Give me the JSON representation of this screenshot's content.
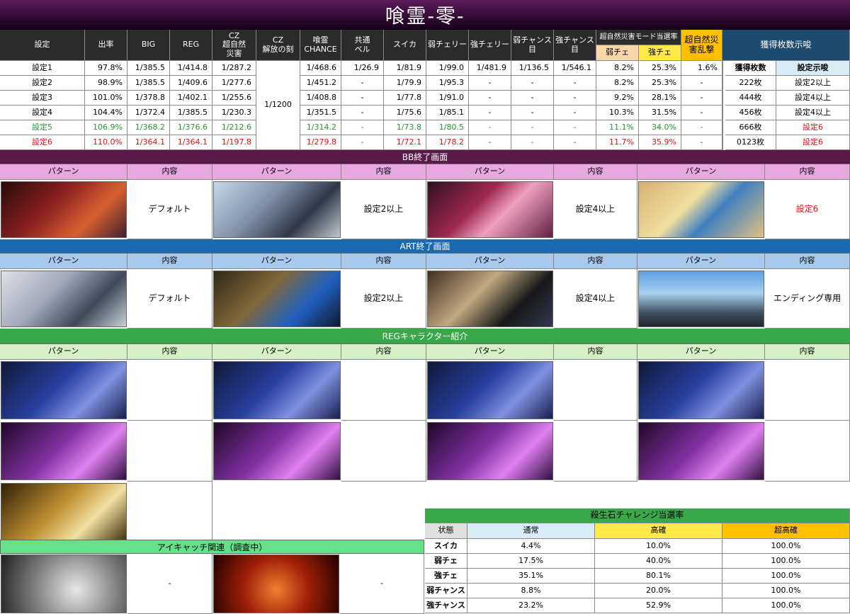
{
  "title": "喰霊-零-",
  "stats": {
    "headers": [
      "設定",
      "出率",
      "BIG",
      "REG",
      "CZ\n超自然\n災害",
      "CZ\n解放の刻",
      "喰霊\nCHANCE",
      "共通\nベル",
      "スイカ",
      "弱チェリー",
      "強チェリー",
      "弱チャンス\n目",
      "強チャンス\n目"
    ],
    "mode_header": "超自然災害モード当選率",
    "mode_sub": [
      "弱チェ",
      "強チェ"
    ],
    "ranbu_header": "超自然災\n害乱撃",
    "kakutoku_header": "獲得枚数示唆",
    "kakutoku_sub": [
      "獲得枚数",
      "設定示唆"
    ],
    "cz_kai": "1/1200",
    "rows": [
      [
        "設定1",
        "97.8%",
        "1/385.5",
        "1/414.8",
        "1/287.2",
        "1/468.6",
        "1/26.9",
        "1/81.9",
        "1/99.0",
        "1/481.9",
        "1/136.5",
        "1/546.1",
        "8.2%",
        "25.3%",
        "1.6%"
      ],
      [
        "設定2",
        "98.9%",
        "1/385.5",
        "1/409.6",
        "1/277.6",
        "1/451.2",
        "-",
        "1/79.9",
        "1/95.3",
        "-",
        "-",
        "-",
        "8.2%",
        "25.3%",
        "-"
      ],
      [
        "設定3",
        "101.0%",
        "1/378.8",
        "1/402.1",
        "1/255.6",
        "1/408.8",
        "-",
        "1/77.8",
        "1/91.0",
        "-",
        "-",
        "-",
        "9.2%",
        "28.1%",
        "-"
      ],
      [
        "設定4",
        "104.4%",
        "1/372.4",
        "1/385.5",
        "1/230.3",
        "1/351.5",
        "-",
        "1/75.6",
        "1/85.1",
        "-",
        "-",
        "-",
        "10.3%",
        "31.5%",
        "-"
      ],
      [
        "設定5",
        "106.9%",
        "1/368.2",
        "1/376.6",
        "1/212.6",
        "1/314.2",
        "-",
        "1/73.8",
        "1/80.5",
        "-",
        "-",
        "-",
        "11.1%",
        "34.0%",
        "-"
      ],
      [
        "設定6",
        "110.0%",
        "1/364.1",
        "1/364.1",
        "1/197.8",
        "1/279.8",
        "-",
        "1/72.1",
        "1/78.2",
        "-",
        "-",
        "-",
        "11.7%",
        "35.9%",
        "-"
      ]
    ],
    "kakutoku_rows": [
      [
        "222枚",
        "設定2以上"
      ],
      [
        "444枚",
        "設定4以上"
      ],
      [
        "456枚",
        "設定4以上"
      ],
      [
        "666枚",
        "設定6"
      ],
      [
        "0123枚",
        "設定6"
      ]
    ]
  },
  "bb": {
    "title": "BB終了画面",
    "col_pattern": "パターン",
    "col_content": "内容",
    "items": [
      "デフォルト",
      "設定2以上",
      "設定4以上",
      "設定6"
    ]
  },
  "art": {
    "title": "ART終了画面",
    "col_pattern": "パターン",
    "col_content": "内容",
    "items": [
      "デフォルト",
      "設定2以上",
      "設定4以上",
      "エンディング専用"
    ]
  },
  "reg": {
    "title": "REGキャラクター紹介",
    "col_pattern": "パターン",
    "col_content": "内容"
  },
  "eyecatch": {
    "title": "アイキャッチ関連（調査中）",
    "items": [
      "-",
      "-"
    ]
  },
  "sessho": {
    "title": "殺生石チャレンジ当選率",
    "headers": [
      "状態",
      "通常",
      "高確",
      "超高確"
    ],
    "rows": [
      [
        "スイカ",
        "4.4%",
        "10.0%",
        "100.0%"
      ],
      [
        "弱チェ",
        "17.5%",
        "40.0%",
        "100.0%"
      ],
      [
        "強チェ",
        "35.1%",
        "80.1%",
        "100.0%"
      ],
      [
        "弱チャンス",
        "8.8%",
        "20.0%",
        "100.0%"
      ],
      [
        "強チャンス",
        "23.2%",
        "52.9%",
        "100.0%"
      ]
    ]
  },
  "colors": {
    "title_bg": "#3a0f3a",
    "bb_bar": "#5a1a4a",
    "bb_head": "#e8a8e0",
    "art_bar": "#1a6ab0",
    "art_head": "#a8c8ec",
    "reg_bar": "#3aa84a",
    "reg_head": "#d8f0c8",
    "yellow": "#ffe84a",
    "orange": "#ffc000"
  }
}
